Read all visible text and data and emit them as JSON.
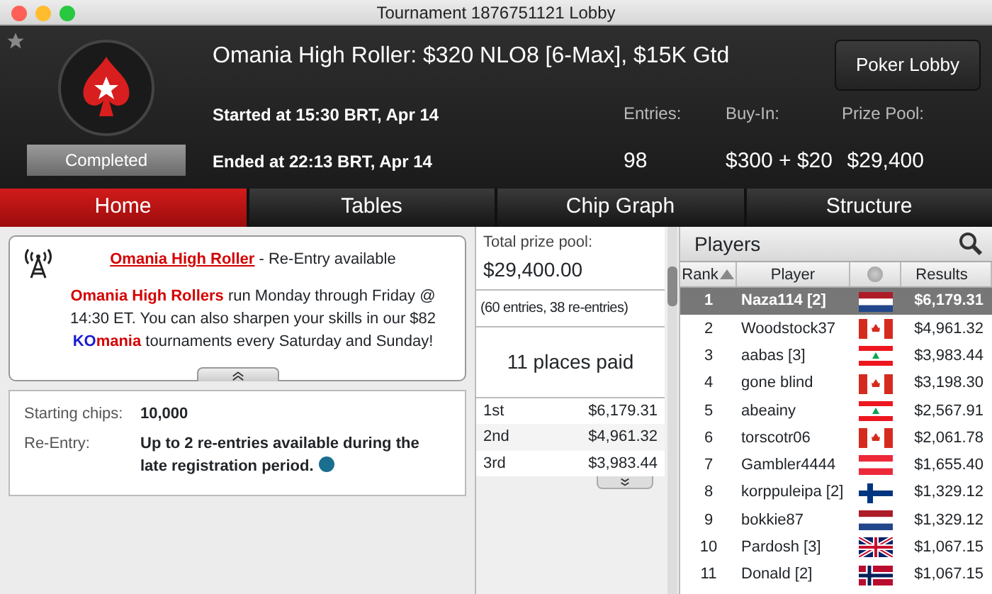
{
  "window": {
    "title": "Tournament 1876751121 Lobby"
  },
  "header": {
    "title": "Omania High Roller: $320 NLO8 [6-Max], $15K Gtd",
    "status": "Completed",
    "started": "Started at 15:30 BRT, Apr 14",
    "ended": "Ended at 22:13 BRT, Apr 14",
    "button": "Poker Lobby",
    "stats": [
      {
        "label": "Entries:",
        "value": "98"
      },
      {
        "label": "Buy-In:",
        "value": "$300 + $20"
      },
      {
        "label": "Prize Pool:",
        "value": "$29,400"
      }
    ]
  },
  "tabs": [
    {
      "label": "Home",
      "selected": true
    },
    {
      "label": "Tables",
      "selected": false
    },
    {
      "label": "Chip Graph",
      "selected": false
    },
    {
      "label": "Structure",
      "selected": false
    }
  ],
  "message": {
    "paragraphs": [
      [
        {
          "text": "Omania High Roller",
          "kind": "link"
        },
        {
          "text": " - Re-Entry available",
          "kind": "plain"
        }
      ],
      [
        {
          "text": "Omania High Rollers",
          "kind": "red"
        },
        {
          "text": " run Monday through Friday @ 14:30 ET. You can also sharpen your skills in our $82 ",
          "kind": "plain"
        },
        {
          "text": "KO",
          "kind": "blue"
        },
        {
          "text": "mania",
          "kind": "red"
        },
        {
          "text": " tournaments every Saturday and Sunday!",
          "kind": "plain"
        }
      ]
    ]
  },
  "details": [
    {
      "label": "Starting chips:",
      "value": "10,000",
      "info": false
    },
    {
      "label": "Re-Entry:",
      "value": "Up to 2 re-entries available during the late registration period.",
      "info": true
    }
  ],
  "prizes": {
    "label": "Total prize pool:",
    "total": "$29,400.00",
    "entries": "(60 entries, 38 re-entries)",
    "paid": "11 places paid",
    "places": [
      {
        "place": "1st",
        "amount": "$6,179.31"
      },
      {
        "place": "2nd",
        "amount": "$4,961.32"
      },
      {
        "place": "3rd",
        "amount": "$3,983.44"
      }
    ]
  },
  "players": {
    "title": "Players",
    "columns": [
      "Rank",
      "Player",
      "Results"
    ],
    "rows": [
      {
        "rank": "1",
        "player": "Naza114 [2]",
        "kind": "nl",
        "result": "$6,179.31",
        "selected": true
      },
      {
        "rank": "2",
        "player": "Woodstock37",
        "kind": "ca",
        "result": "$4,961.32",
        "selected": false
      },
      {
        "rank": "3",
        "player": "aabas [3]",
        "kind": "lb",
        "result": "$3,983.44",
        "selected": false
      },
      {
        "rank": "4",
        "player": "gone blind",
        "kind": "ca",
        "result": "$3,198.30",
        "selected": false
      },
      {
        "rank": "5",
        "player": "abeainy",
        "kind": "lb",
        "result": "$2,567.91",
        "selected": false
      },
      {
        "rank": "6",
        "player": "torscotr06",
        "kind": "ca",
        "result": "$2,061.78",
        "selected": false
      },
      {
        "rank": "7",
        "player": "Gambler4444",
        "kind": "at",
        "result": "$1,655.40",
        "selected": false
      },
      {
        "rank": "8",
        "player": "korppuleipa [2]",
        "kind": "fi",
        "result": "$1,329.12",
        "selected": false
      },
      {
        "rank": "9",
        "player": "bokkie87",
        "kind": "nl",
        "result": "$1,329.12",
        "selected": false
      },
      {
        "rank": "10",
        "player": "Pardosh [3]",
        "kind": "gb",
        "result": "$1,067.15",
        "selected": false
      },
      {
        "rank": "11",
        "player": "Donald [2]",
        "kind": "no",
        "result": "$1,067.15",
        "selected": false
      }
    ]
  }
}
